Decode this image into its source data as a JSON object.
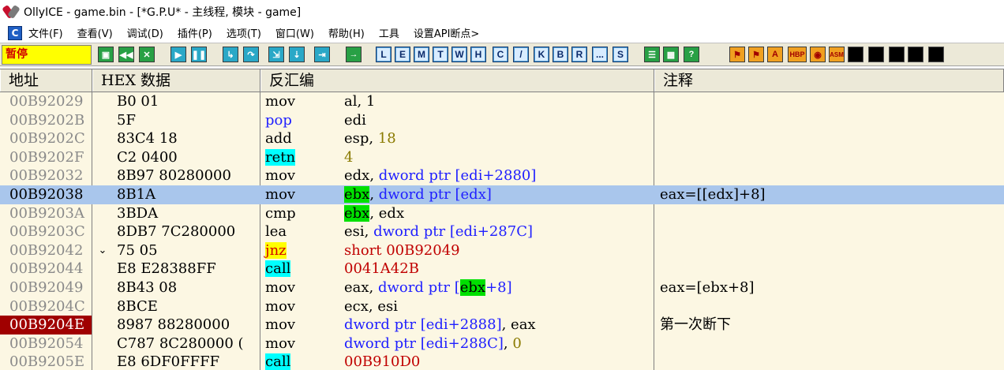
{
  "window": {
    "title": "OllyICE - game.bin - [*G.P.U* -  主线程, 模块 - game]"
  },
  "menu": {
    "icon_letter": "C",
    "items": [
      "文件(F)",
      "查看(V)",
      "调试(D)",
      "插件(P)",
      "选项(T)",
      "窗口(W)",
      "帮助(H)",
      "工具",
      "设置API断点>"
    ]
  },
  "toolbar": {
    "status": "暂停",
    "letter_buttons": [
      "L",
      "E",
      "M",
      "T",
      "W",
      "H",
      "C",
      "/",
      "K",
      "B",
      "R",
      "...",
      "S"
    ],
    "right_buttons": [
      "HBP",
      "ASM"
    ]
  },
  "table": {
    "headers": {
      "address": "地址",
      "hex": "HEX 数据",
      "disasm": "反汇编",
      "comment": "注释"
    },
    "rows": [
      {
        "addr": "00B92029",
        "hex": "B0 01",
        "mnemonic": "mov",
        "operand": "al, 1",
        "comment": ""
      },
      {
        "addr": "00B9202B",
        "hex": "5F",
        "mnemonic": "pop",
        "operand": "edi",
        "comment": ""
      },
      {
        "addr": "00B9202C",
        "hex": "83C4 18",
        "mnemonic": "add",
        "operand": "esp, 18",
        "comment": ""
      },
      {
        "addr": "00B9202F",
        "hex": "C2 0400",
        "mnemonic": "retn",
        "operand": "4",
        "comment": ""
      },
      {
        "addr": "00B92032",
        "hex": "8B97 80280000",
        "mnemonic": "mov",
        "operand": "edx, dword ptr [edi+2880]",
        "comment": ""
      },
      {
        "addr": "00B92038",
        "hex": "8B1A",
        "mnemonic": "mov",
        "operand": "ebx, dword ptr [edx]",
        "comment": "eax=[[edx]+8]"
      },
      {
        "addr": "00B9203A",
        "hex": "3BDA",
        "mnemonic": "cmp",
        "operand": "ebx, edx",
        "comment": ""
      },
      {
        "addr": "00B9203C",
        "hex": "8DB7 7C280000",
        "mnemonic": "lea",
        "operand": "esi, dword ptr [edi+287C]",
        "comment": ""
      },
      {
        "addr": "00B92042",
        "hex": "75 05",
        "mnemonic": "jnz",
        "operand": "short 00B92049",
        "comment": ""
      },
      {
        "addr": "00B92044",
        "hex": "E8 E28388FF",
        "mnemonic": "call",
        "operand": "0041A42B",
        "comment": ""
      },
      {
        "addr": "00B92049",
        "hex": "8B43 08",
        "mnemonic": "mov",
        "operand": "eax, dword ptr [ebx+8]",
        "comment": "eax=[ebx+8]"
      },
      {
        "addr": "00B9204C",
        "hex": "8BCE",
        "mnemonic": "mov",
        "operand": "ecx, esi",
        "comment": ""
      },
      {
        "addr": "00B9204E",
        "hex": "8987 88280000",
        "mnemonic": "mov",
        "operand": "dword ptr [edi+2888], eax",
        "comment": "第一次断下"
      },
      {
        "addr": "00B92054",
        "hex": "C787 8C280000 (",
        "mnemonic": "mov",
        "operand": "dword ptr [edi+288C], 0",
        "comment": ""
      },
      {
        "addr": "00B9205E",
        "hex": "E8 6DF0FFFF",
        "mnemonic": "call",
        "operand": "00B910D0",
        "comment": ""
      }
    ],
    "jump_arrow": "⌄"
  },
  "colors": {
    "toolbar_bg": "#ece9d8",
    "grid_bg": "#fcf7e3",
    "selected_row": "#a9c6ec",
    "breakpoint": "#a00000",
    "reg_highlight": "#00e000",
    "call_highlight": "#00ffff",
    "jump_highlight": "#ffff00"
  }
}
